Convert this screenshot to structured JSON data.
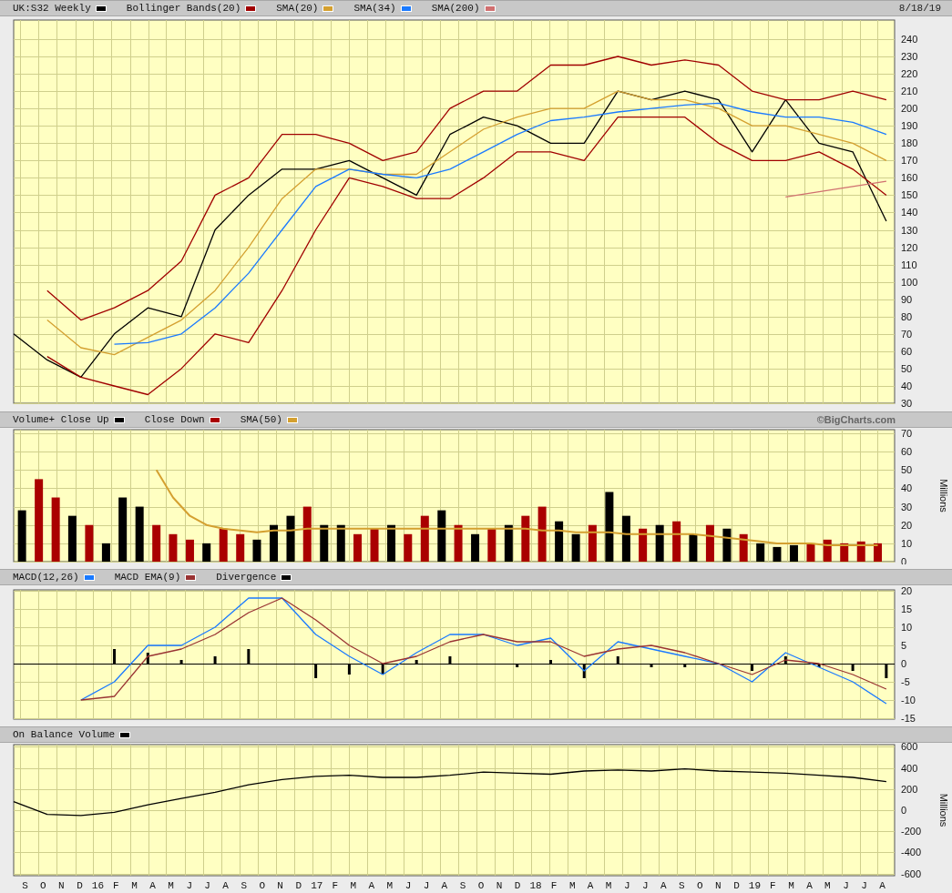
{
  "panels": [
    {
      "date": "8/18/19",
      "chart_data": {
        "type": "line",
        "grid": true,
        "xlim": [
          15.636,
          19.66
        ],
        "ylim": [
          30,
          251
        ],
        "yticks": [
          30,
          40,
          50,
          60,
          70,
          80,
          90,
          100,
          110,
          120,
          130,
          140,
          150,
          160,
          170,
          180,
          190,
          200,
          210,
          220,
          230,
          240
        ],
        "x": [
          15.636,
          15.789,
          15.943,
          16.096,
          16.249,
          16.402,
          16.556,
          16.709,
          16.862,
          17.016,
          17.169,
          17.322,
          17.476,
          17.629,
          17.782,
          17.936,
          18.089,
          18.242,
          18.396,
          18.549,
          18.702,
          18.856,
          19.009,
          19.162,
          19.315,
          19.469,
          19.622
        ],
        "series": [
          {
            "name": "UK:S32 Weekly",
            "color": "#000000",
            "values": [
              70,
              55,
              45,
              70,
              85,
              80,
              130,
              150,
              165,
              165,
              170,
              160,
              150,
              185,
              195,
              190,
              180,
              180,
              210,
              205,
              210,
              205,
              175,
              205,
              180,
              175,
              135
            ]
          },
          {
            "name": "Bollinger Bands(20)",
            "color": "#a00000",
            "values": [
              null,
              95,
              78,
              85,
              95,
              112,
              150,
              160,
              185,
              185,
              180,
              170,
              175,
              200,
              210,
              210,
              225,
              225,
              230,
              225,
              228,
              225,
              210,
              205,
              205,
              210,
              205
            ]
          },
          {
            "color": "#a00000",
            "values": [
              null,
              57,
              45,
              40,
              35,
              50,
              70,
              65,
              95,
              130,
              160,
              155,
              148,
              148,
              160,
              175,
              175,
              170,
              195,
              195,
              195,
              180,
              170,
              170,
              175,
              165,
              150
            ]
          },
          {
            "name": "SMA(20)",
            "color": "#d4a030",
            "values": [
              null,
              78,
              62,
              58,
              68,
              78,
              95,
              120,
              148,
              165,
              165,
              162,
              162,
              175,
              188,
              195,
              200,
              200,
              210,
              205,
              205,
              200,
              190,
              190,
              185,
              180,
              170
            ]
          },
          {
            "name": "SMA(34)",
            "color": "#1a7aff",
            "values": [
              null,
              null,
              null,
              64,
              65,
              70,
              85,
              105,
              130,
              155,
              165,
              162,
              160,
              165,
              175,
              185,
              193,
              195,
              198,
              200,
              202,
              203,
              198,
              195,
              195,
              192,
              185
            ]
          },
          {
            "name": "SMA(200)",
            "color": "#d07070",
            "values": [
              null,
              null,
              null,
              null,
              null,
              null,
              null,
              null,
              null,
              null,
              null,
              null,
              null,
              null,
              null,
              null,
              null,
              null,
              null,
              null,
              null,
              null,
              null,
              149,
              152,
              155,
              158
            ]
          }
        ]
      }
    },
    {
      "credit": "©BigCharts.com",
      "chart_data": {
        "type": "bar",
        "grid": true,
        "ylabel": "Millions",
        "xlim": [
          15.636,
          19.66
        ],
        "ylim": [
          0,
          72
        ],
        "yticks": [
          0,
          10,
          20,
          30,
          40,
          50,
          60,
          70
        ],
        "x": [
          15.674,
          15.751,
          15.828,
          15.904,
          15.981,
          16.058,
          16.134,
          16.211,
          16.288,
          16.364,
          16.441,
          16.517,
          16.594,
          16.671,
          16.747,
          16.824,
          16.901,
          16.977,
          17.054,
          17.131,
          17.207,
          17.284,
          17.361,
          17.437,
          17.514,
          17.591,
          17.667,
          17.744,
          17.82,
          17.897,
          17.974,
          18.05,
          18.127,
          18.204,
          18.28,
          18.357,
          18.434,
          18.51,
          18.587,
          18.664,
          18.74,
          18.817,
          18.894,
          18.97,
          19.047,
          19.123,
          19.2,
          19.277,
          19.353,
          19.43,
          19.507,
          19.583
        ],
        "series": [
          {
            "name": "Volume+ Close Up",
            "color": "#000000",
            "values": [
              28,
              null,
              null,
              25,
              null,
              10,
              35,
              30,
              null,
              null,
              null,
              10,
              null,
              null,
              12,
              20,
              25,
              null,
              20,
              20,
              null,
              null,
              20,
              null,
              null,
              28,
              null,
              15,
              null,
              20,
              null,
              null,
              22,
              15,
              null,
              38,
              25,
              null,
              20,
              null,
              15,
              null,
              18,
              null,
              10,
              8,
              9,
              null,
              null,
              null,
              null,
              null
            ]
          },
          {
            "name": "Close Down",
            "color": "#aa0000",
            "values": [
              null,
              45,
              35,
              null,
              20,
              null,
              null,
              null,
              20,
              15,
              12,
              null,
              18,
              15,
              null,
              null,
              null,
              30,
              null,
              null,
              15,
              18,
              null,
              15,
              25,
              null,
              20,
              null,
              18,
              null,
              25,
              30,
              null,
              null,
              20,
              null,
              null,
              18,
              null,
              22,
              null,
              20,
              null,
              15,
              null,
              null,
              null,
              10,
              12,
              10,
              11,
              10
            ]
          },
          {
            "name": "SMA(50)",
            "type": "line",
            "color": "#d4a030",
            "values": [
              null,
              null,
              null,
              null,
              null,
              null,
              null,
              null,
              50,
              35,
              25,
              20,
              18,
              17,
              16,
              17,
              17,
              18,
              18,
              18,
              18,
              18,
              18,
              18,
              18,
              18,
              18,
              18,
              18,
              18,
              18,
              17,
              17,
              16,
              16,
              16,
              15,
              15,
              15,
              15,
              15,
              14,
              13,
              12,
              11,
              10,
              10,
              10,
              9,
              9,
              9,
              9
            ]
          }
        ]
      }
    },
    {
      "chart_data": {
        "type": "line",
        "grid": true,
        "xlim": [
          15.636,
          19.66
        ],
        "ylim": [
          -15.25,
          20.25
        ],
        "yticks": [
          -15,
          -10,
          -5,
          0,
          5,
          10,
          15,
          20
        ],
        "x": [
          15.943,
          16.096,
          16.249,
          16.402,
          16.556,
          16.709,
          16.862,
          17.016,
          17.169,
          17.322,
          17.476,
          17.629,
          17.782,
          17.936,
          18.089,
          18.242,
          18.396,
          18.549,
          18.702,
          18.856,
          19.009,
          19.162,
          19.315,
          19.469,
          19.622
        ],
        "series": [
          {
            "name": "MACD(12,26)",
            "color": "#1a7aff",
            "values": [
              -10,
              -5,
              5,
              5,
              10,
              18,
              18,
              8,
              2,
              -3,
              3,
              8,
              8,
              5,
              7,
              -2,
              6,
              4,
              2,
              0,
              -5,
              3,
              -1,
              -5,
              -11
            ]
          },
          {
            "name": "MACD EMA(9)",
            "color": "#993333",
            "values": [
              -10,
              -9,
              2,
              4,
              8,
              14,
              18,
              12,
              5,
              0,
              2,
              6,
              8,
              6,
              6,
              2,
              4,
              5,
              3,
              0,
              -3,
              1,
              0,
              -3,
              -7
            ]
          },
          {
            "name": "Divergence",
            "type": "bar",
            "color": "#000000",
            "values": [
              null,
              4,
              3,
              1,
              2,
              4,
              null,
              -4,
              -3,
              -3,
              1,
              2,
              null,
              -1,
              1,
              -4,
              2,
              -1,
              -1,
              null,
              -2,
              2,
              -1,
              -2,
              -4
            ]
          }
        ]
      }
    },
    {
      "chart_data": {
        "type": "line",
        "grid": true,
        "ylabel": "Millions",
        "xlim": [
          15.636,
          19.66
        ],
        "ylim": [
          -620,
          620
        ],
        "yticks": [
          -600,
          -400,
          -200,
          0,
          200,
          400,
          600
        ],
        "xticks": [
          {
            "value": 15.667,
            "label": "S"
          },
          {
            "value": 15.75,
            "label": "O"
          },
          {
            "value": 15.833,
            "label": "N"
          },
          {
            "value": 15.917,
            "label": "D"
          },
          {
            "value": 16,
            "label": "16"
          },
          {
            "value": 16.083,
            "label": "F"
          },
          {
            "value": 16.167,
            "label": "M"
          },
          {
            "value": 16.25,
            "label": "A"
          },
          {
            "value": 16.333,
            "label": "M"
          },
          {
            "value": 16.417,
            "label": "J"
          },
          {
            "value": 16.5,
            "label": "J"
          },
          {
            "value": 16.583,
            "label": "A"
          },
          {
            "value": 16.667,
            "label": "S"
          },
          {
            "value": 16.75,
            "label": "O"
          },
          {
            "value": 16.833,
            "label": "N"
          },
          {
            "value": 16.917,
            "label": "D"
          },
          {
            "value": 17,
            "label": "17"
          },
          {
            "value": 17.083,
            "label": "F"
          },
          {
            "value": 17.167,
            "label": "M"
          },
          {
            "value": 17.25,
            "label": "A"
          },
          {
            "value": 17.333,
            "label": "M"
          },
          {
            "value": 17.417,
            "label": "J"
          },
          {
            "value": 17.5,
            "label": "J"
          },
          {
            "value": 17.583,
            "label": "A"
          },
          {
            "value": 17.667,
            "label": "S"
          },
          {
            "value": 17.75,
            "label": "O"
          },
          {
            "value": 17.833,
            "label": "N"
          },
          {
            "value": 17.917,
            "label": "D"
          },
          {
            "value": 18,
            "label": "18"
          },
          {
            "value": 18.083,
            "label": "F"
          },
          {
            "value": 18.167,
            "label": "M"
          },
          {
            "value": 18.25,
            "label": "A"
          },
          {
            "value": 18.333,
            "label": "M"
          },
          {
            "value": 18.417,
            "label": "J"
          },
          {
            "value": 18.5,
            "label": "J"
          },
          {
            "value": 18.583,
            "label": "A"
          },
          {
            "value": 18.667,
            "label": "S"
          },
          {
            "value": 18.75,
            "label": "O"
          },
          {
            "value": 18.833,
            "label": "N"
          },
          {
            "value": 18.917,
            "label": "D"
          },
          {
            "value": 19,
            "label": "19"
          },
          {
            "value": 19.083,
            "label": "F"
          },
          {
            "value": 19.167,
            "label": "M"
          },
          {
            "value": 19.25,
            "label": "A"
          },
          {
            "value": 19.333,
            "label": "M"
          },
          {
            "value": 19.417,
            "label": "J"
          },
          {
            "value": 19.5,
            "label": "J"
          },
          {
            "value": 19.583,
            "label": "A"
          }
        ],
        "x": [
          15.636,
          15.789,
          15.943,
          16.096,
          16.249,
          16.402,
          16.556,
          16.709,
          16.862,
          17.016,
          17.169,
          17.322,
          17.476,
          17.629,
          17.782,
          17.936,
          18.089,
          18.242,
          18.396,
          18.549,
          18.702,
          18.856,
          19.009,
          19.162,
          19.315,
          19.469,
          19.622
        ],
        "series": [
          {
            "name": "On Balance Volume",
            "color": "#000000",
            "values": [
              80,
              -40,
              -50,
              -20,
              50,
              110,
              170,
              240,
              290,
              320,
              330,
              310,
              310,
              330,
              360,
              350,
              340,
              370,
              380,
              370,
              390,
              370,
              360,
              350,
              330,
              310,
              270
            ]
          }
        ]
      }
    }
  ]
}
